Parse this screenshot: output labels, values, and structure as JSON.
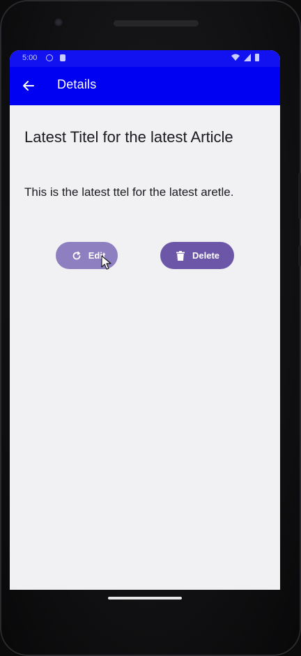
{
  "status_bar": {
    "time": "5:00"
  },
  "app_bar": {
    "back_icon": "arrow-left-icon",
    "title": "Details"
  },
  "article": {
    "title": "Latest Titel for the latest Article",
    "body": "This is the latest ttel for the latest aretle."
  },
  "actions": {
    "edit_label": "Edit",
    "edit_icon": "refresh-icon",
    "delete_label": "Delete",
    "delete_icon": "trash-icon"
  },
  "colors": {
    "app_bar": "#0000f2",
    "screen_background": "#f1f0f3",
    "edit_button": "#8e7fc0",
    "delete_button": "#6b56a8"
  }
}
